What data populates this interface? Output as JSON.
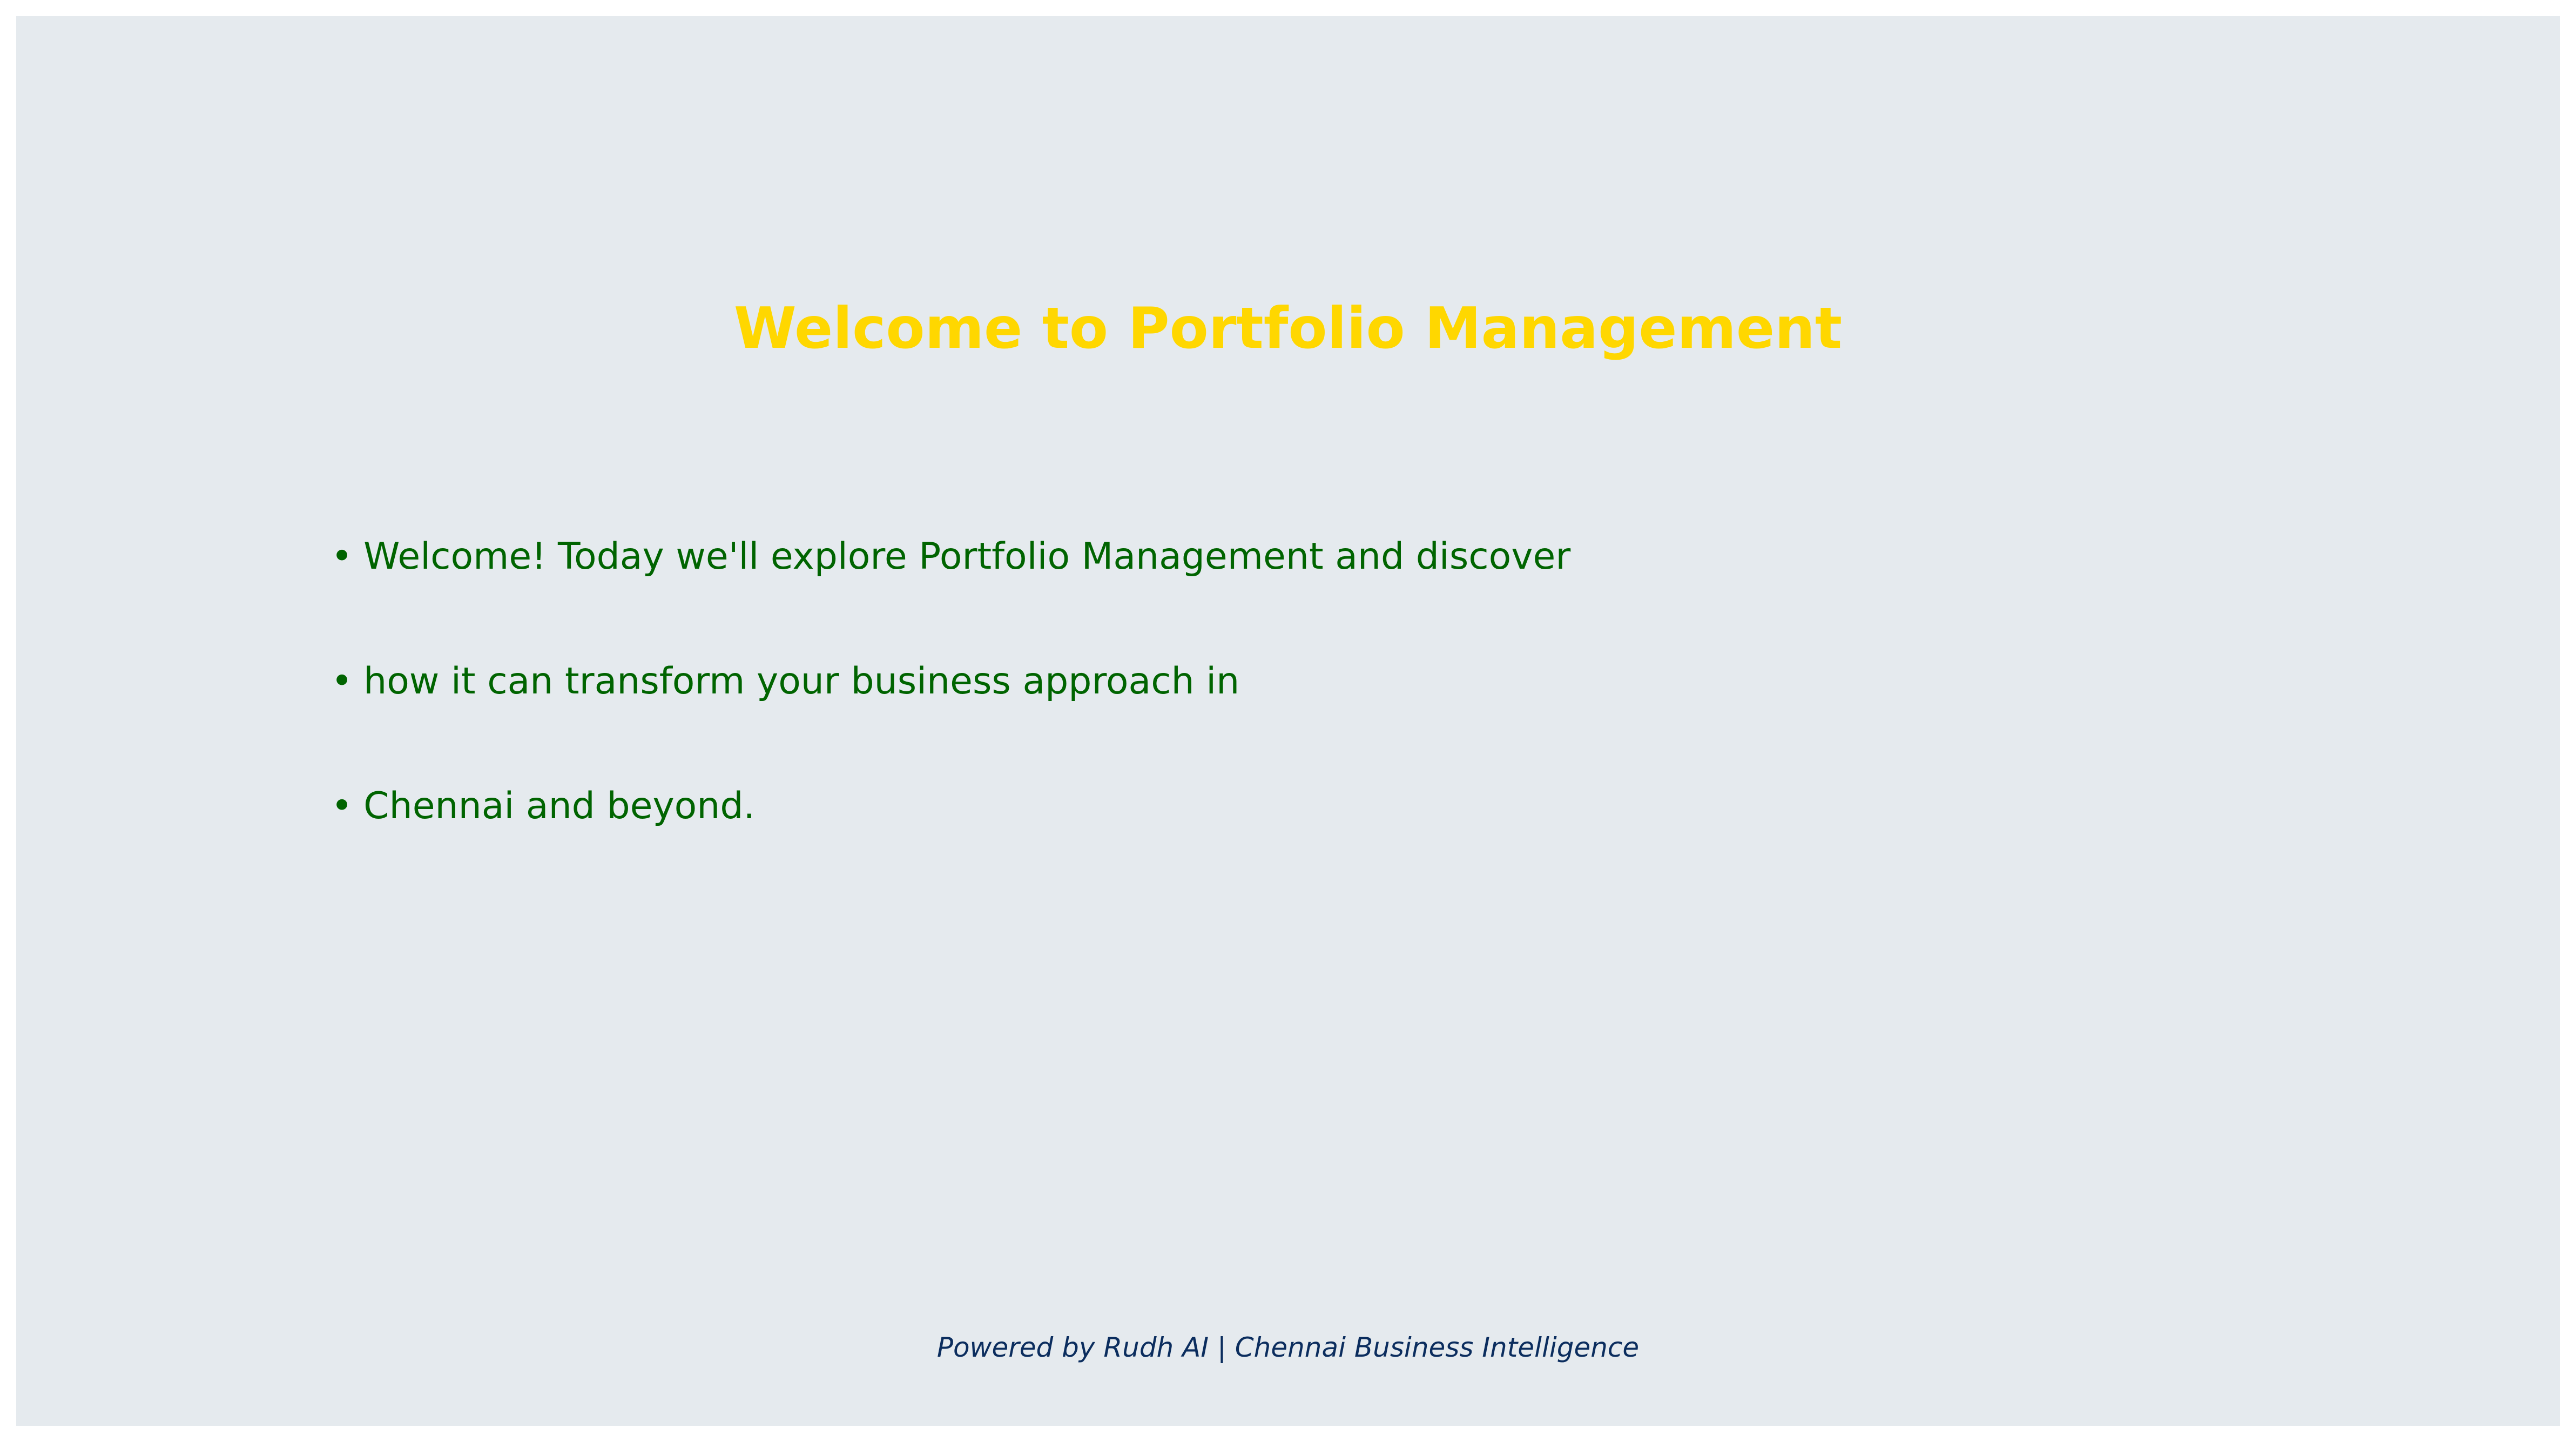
{
  "slide": {
    "title": "Welcome to Portfolio Management",
    "bullet_marker": "•",
    "bullets": [
      "Welcome! Today we'll explore Portfolio Management and discover",
      "how it can transform your business approach in",
      "Chennai and beyond."
    ],
    "footer": "Powered by Rudh AI | Chennai Business Intelligence"
  },
  "colors": {
    "background": "#e5eaee",
    "title": "#ffd700",
    "bullet_text": "#006400",
    "footer_text": "#0b2d5e"
  }
}
